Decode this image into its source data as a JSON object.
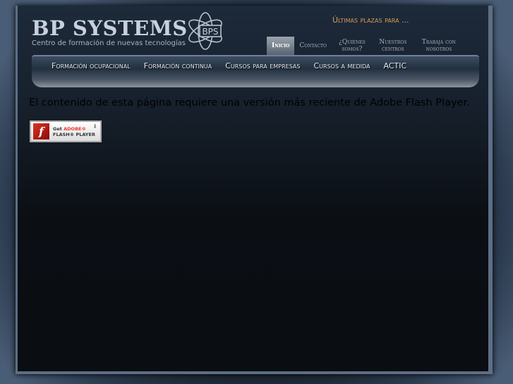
{
  "header": {
    "logo_text": "BP SYSTEMS",
    "logo_badge": "BPS",
    "tagline": "Centro de formación de nuevas tecnologías",
    "ultimas": "Últimas plazas para ..."
  },
  "top_nav": [
    {
      "label": "Inicio",
      "active": true
    },
    {
      "label": "Contacto"
    },
    {
      "label": "¿Quiénes somos?"
    },
    {
      "label": "Nuestros centros"
    },
    {
      "label": "Trabaja con nosotros"
    }
  ],
  "main_nav": [
    {
      "label": "Formación ocupacional"
    },
    {
      "label": "Formación continua"
    },
    {
      "label": "Cursos para empresas"
    },
    {
      "label": "Cursos a medida"
    },
    {
      "label": "ACTIC"
    }
  ],
  "content": {
    "message": "El contenido de esta página requiere una versión más reciente de Adobe Flash Player.",
    "flash_button": {
      "get": "Get",
      "adobe": "ADOBE®",
      "player": "FLASH® PLAYER"
    }
  }
}
